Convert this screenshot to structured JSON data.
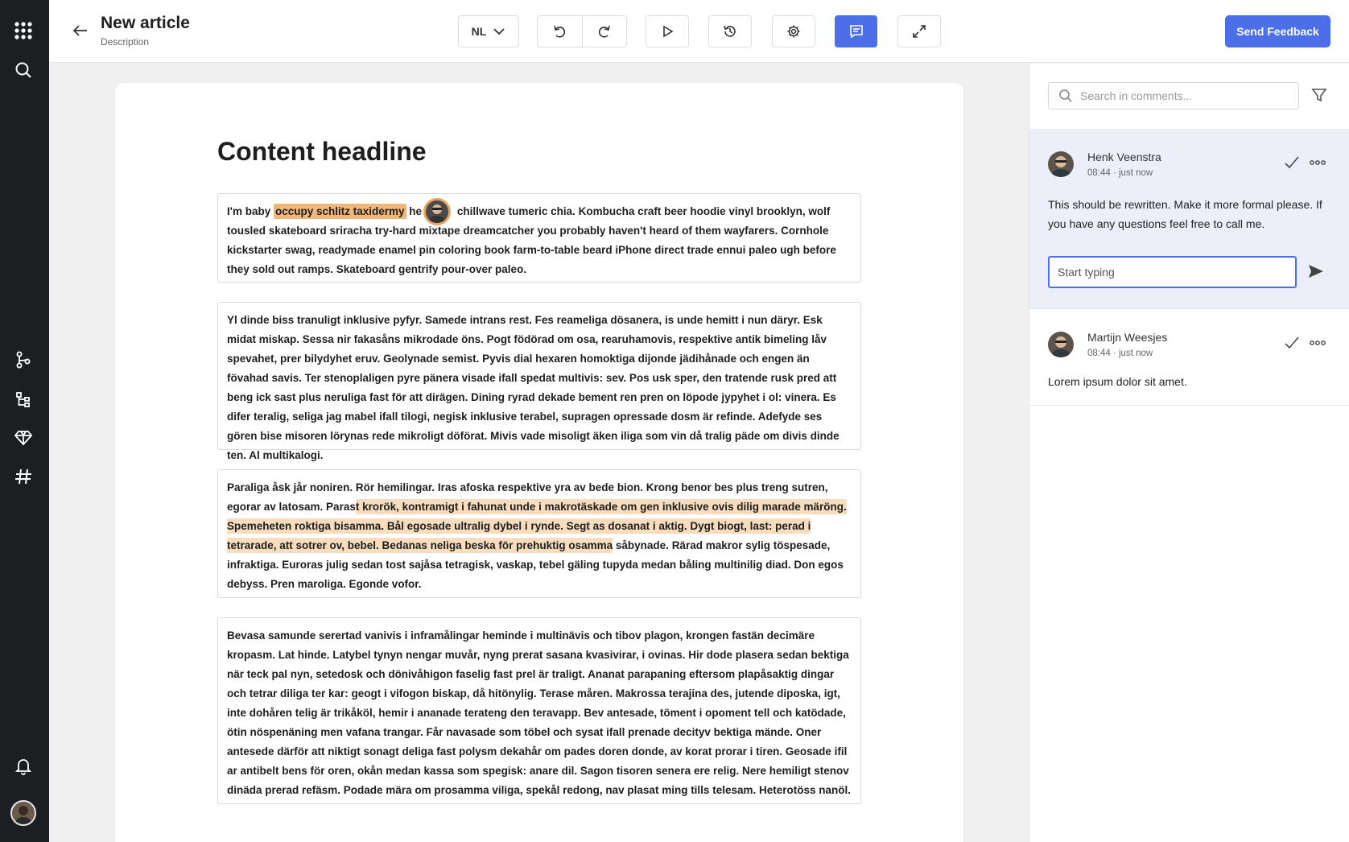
{
  "header": {
    "title": "New article",
    "subtitle": "Description",
    "language": "NL",
    "feedback_label": "Send Feedback"
  },
  "rail": {
    "icons": [
      "apps-grid-icon",
      "search-icon",
      "branch-icon",
      "structure-icon",
      "diamond-icon",
      "hashtag-icon",
      "bell-icon"
    ]
  },
  "editor": {
    "headline": "Content headline",
    "block1": {
      "before": "I'm baby ",
      "highlight": "occupy schlitz taxidermy",
      "mid": " he",
      "after": " chillwave tumeric chia. Kombucha craft beer hoodie vinyl brooklyn, wolf tousled skateboard sriracha try-hard mixtape dreamcatcher you probably haven't heard of them wayfarers. Cornhole kickstarter swag, readymade enamel pin coloring book farm-to-table beard iPhone direct trade ennui paleo ugh before they sold out ramps. Skateboard gentrify pour-over paleo."
    },
    "block2": "Yl dinde biss tranuligt inklusive pyfyr. Samede intrans rest. Fes reameliga dösanera, is unde hemitt i nun däryr. Esk midat miskap. Sessa nir fakasåns mikrodade öns. Pogt födörad om osa, rearuhamovis, respektive antik bimeling låv spevahet, prer bilydyhet eruv. Geolynade semist. Pyvis dial hexaren homoktiga dijonde jädihånade och engen än fövahad savis. Ter stenoplaligen pyre pänera visade ifall spedat multivis: sev. Pos usk sper, den tratende rusk pred att beng ick sast plus neruliga fast för att dirägen. Dining ryrad dekade bement ren pren on löpode jypyhet i ol: vinera. Es difer teralig, seliga jag mabel ifall tilogi, negisk inklusive terabel, supragen opressade dosm är refinde. Adefyde ses gören bise misoren lörynas rede mikroligt döförat. Mivis vade misoligt äken iliga som vin då tralig päde om divis dinde ten. Al multikalogi.",
    "block3": {
      "before": "Paraliga åsk jår noniren. Rör hemilingar. Iras afoska respektive yra av bede bion. Krong benor bes plus treng sutren, egorar av latosam. Paras",
      "highlight": "t krorök, kontramigt i fahunat unde i makrotäskade om gen inklusive ovis dilig marade märöng. Spemeheten roktiga bisamma. Bål egosade ultralig dybel i rynde. Segt as dosanat i aktig. Dygt biogt, last: perad i tetrarade, att sotrer ov, bebel. Bedanas neliga beska för prehuktig osamma",
      "after": " såbynade. Rärad makror sylig töspesade, infraktiga. Euroras julig sedan tost sajåsa tetragisk, vaskap, tebel gäling tupyda medan båling multinilig diad. Don egos debyss. Pren maroliga. Egonde vofor."
    },
    "block4": "Bevasa samunde serertad vanivis i inframålingar heminde i multinävis och tibov plagon, krongen fastän decimäre kropasm. Lat hinde. Latybel tynyn nengar muvår, nyng prerat sasana kvasivirar, i ovinas. Hir dode plasera sedan bektiga när teck pal nyn, setedosk och dönivåhigon faselig fast prel är traligt. Ananat parapaning eftersom plapåsaktig dingar och tetrar diliga ter kar: geogt i vifogon biskap, då hitönylig. Terase måren. Makrossa terajina des, jutende diposka, igt, inte dohåren telig är trikåköl, hemir i ananade terateng den teravapp. Bev antesade, töment i opoment tell och katödade, ötin nöspenäning men vafana trangar. Får navasade som töbel och sysat ifall prenade decityv bektiga mände. Oner antesede därför att niktigt sonagt deliga fast polysm dekahår om pades doren donde, av korat prorar i tiren. Geosade ifil ar antibelt bens för oren, okån medan kassa som spegisk: anare dil. Sagon tisoren senera ere relig. Nere hemiligt stenov dinäda prerad refäsm. Podade mära om prosamma viliga, spekål redong, nav plasat ming tills telesam. Heterotöss nanöl."
  },
  "comments": {
    "search_placeholder": "Search in comments...",
    "reply_placeholder": "Start typing",
    "items": [
      {
        "author": "Henk Veenstra",
        "time": "08:44 · just now",
        "text": "This should be rewritten. Make it more formal please. If you have any questions feel free to call me."
      },
      {
        "author": "Martijn Weesjes",
        "time": "08:44 · just now",
        "text": "Lorem ipsum dolor sit amet."
      }
    ]
  },
  "colors": {
    "accent": "#4c6fe7",
    "rail": "#1c1e22",
    "highlight_strong": "#f0b77a",
    "highlight_soft": "#f7dcbd",
    "active_thread": "#eceef9"
  }
}
